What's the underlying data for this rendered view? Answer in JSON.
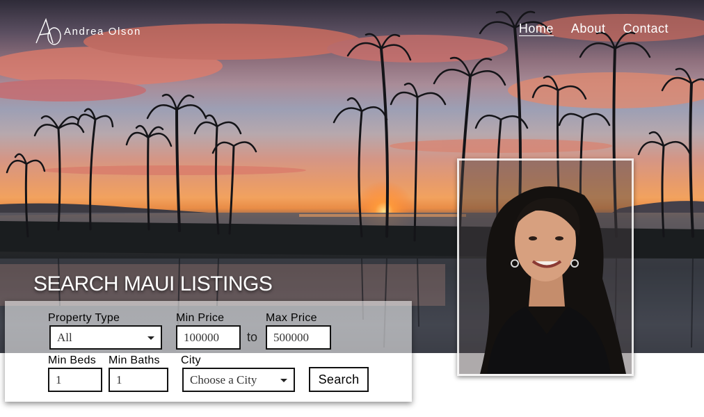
{
  "brand": {
    "name": "Andrea Olson",
    "monogram": "AO"
  },
  "nav": {
    "items": [
      "Home",
      "About",
      "Contact"
    ],
    "active": "Home"
  },
  "search": {
    "title": "SEARCH MAUI LISTINGS",
    "property_type": {
      "label": "Property Type",
      "value": "All"
    },
    "min_price": {
      "label": "Min Price",
      "value": "100000"
    },
    "to_label": "to",
    "max_price": {
      "label": "Max Price",
      "value": "500000"
    },
    "min_beds": {
      "label": "Min Beds",
      "value": "1"
    },
    "min_baths": {
      "label": "Min Baths",
      "value": "1"
    },
    "city": {
      "label": "City",
      "value": "Choose a City"
    },
    "submit_label": "Search"
  },
  "colors": {
    "sunset_orange": "#f2a25e",
    "panel_white": "#ffffff",
    "border": "#111111"
  }
}
